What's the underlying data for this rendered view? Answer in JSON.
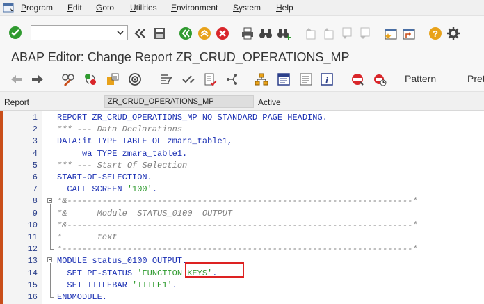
{
  "menu": {
    "items": [
      {
        "label": "Program",
        "ul": "P",
        "rest": "rogram"
      },
      {
        "label": "Edit",
        "ul": "E",
        "rest": "dit"
      },
      {
        "label": "Goto",
        "ul": "G",
        "rest": "oto"
      },
      {
        "label": "Utilities",
        "ul": "U",
        "rest": "tilities"
      },
      {
        "label": "Environment",
        "ul": "E",
        "rest": "nvironment"
      },
      {
        "label": "System",
        "ul": "S",
        "rest": "ystem"
      },
      {
        "label": "Help",
        "ul": "H",
        "rest": "elp"
      }
    ]
  },
  "toolbar": {
    "command_field_value": ""
  },
  "title": "ABAP Editor: Change Report ZR_CRUD_OPERATIONS_MP",
  "app_toolbar": {
    "pattern_label": "Pattern",
    "pretty_label": "Pret"
  },
  "report_line": {
    "label": "Report",
    "value": "ZR_CRUD_OPERATIONS_MP",
    "status": "Active"
  },
  "editor": {
    "line_numbers": [
      "1",
      "2",
      "3",
      "4",
      "5",
      "6",
      "7",
      "8",
      "9",
      "10",
      "11",
      "12",
      "13",
      "14",
      "15",
      "16"
    ],
    "lines": [
      [
        {
          "t": "REPORT ZR_CRUD_OPERATIONS_MP NO STANDARD PAGE HEADING.",
          "c": "kw"
        }
      ],
      [
        {
          "t": "*** --- Data Declarations",
          "c": "cm"
        }
      ],
      [
        {
          "t": "DATA:it TYPE TABLE OF zmara_table1,",
          "c": "kw"
        }
      ],
      [
        {
          "t": "     wa TYPE zmara_table1.",
          "c": "kw"
        }
      ],
      [
        {
          "t": "*** --- Start Of Selection",
          "c": "cm"
        }
      ],
      [
        {
          "t": "START-OF-SELECTION.",
          "c": "kw"
        }
      ],
      [
        {
          "t": "  CALL SCREEN ",
          "c": "kw"
        },
        {
          "t": "'100'",
          "c": "st"
        },
        {
          "t": ".",
          "c": "kw"
        }
      ],
      [
        {
          "t": "*&---------------------------------------------------------------------*",
          "c": "cm"
        }
      ],
      [
        {
          "t": "*&      Module  STATUS_0100  OUTPUT",
          "c": "cm"
        }
      ],
      [
        {
          "t": "*&---------------------------------------------------------------------*",
          "c": "cm"
        }
      ],
      [
        {
          "t": "*       text",
          "c": "cm"
        }
      ],
      [
        {
          "t": "*----------------------------------------------------------------------*",
          "c": "cm"
        }
      ],
      [
        {
          "t": "MODULE status_0100 OUTPUT.",
          "c": "kw"
        }
      ],
      [
        {
          "t": "  SET PF-STATUS ",
          "c": "kw"
        },
        {
          "t": "'FUNCTION KEYS'",
          "c": "st"
        },
        {
          "t": ".",
          "c": "kw"
        }
      ],
      [
        {
          "t": "  SET TITLEBAR ",
          "c": "kw"
        },
        {
          "t": "'TITLE1'",
          "c": "st"
        },
        {
          "t": ".",
          "c": "kw"
        }
      ],
      [
        {
          "t": "ENDMODULE.",
          "c": "kw"
        }
      ]
    ]
  },
  "colors": {
    "keyword": "#1a2fb3",
    "comment": "#808080",
    "string": "#2e9a2e",
    "highlight_box": "#dd2222"
  }
}
